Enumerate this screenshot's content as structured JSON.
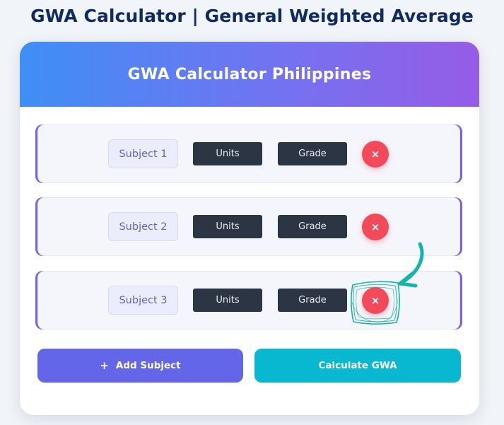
{
  "page": {
    "title": "GWA Calculator | General Weighted Average"
  },
  "card": {
    "header_title": "GWA Calculator Philippines"
  },
  "subjects": [
    {
      "label": "Subject 1",
      "units_placeholder": "Units",
      "grade_placeholder": "Grade",
      "remove_icon": "×"
    },
    {
      "label": "Subject 2",
      "units_placeholder": "Units",
      "grade_placeholder": "Grade",
      "remove_icon": "×"
    },
    {
      "label": "Subject 3",
      "units_placeholder": "Units",
      "grade_placeholder": "Grade",
      "remove_icon": "×"
    }
  ],
  "actions": {
    "add_icon": "+",
    "add_label": "Add Subject",
    "calculate_label": "Calculate GWA"
  },
  "colors": {
    "title": "#0f2b61",
    "header_gradient_start": "#3f8ef6",
    "header_gradient_end": "#965ce6",
    "row_accent": "#7a61e8",
    "input_background": "#2c3544",
    "remove_button": "#f34a5b",
    "add_button": "#6466ea",
    "calculate_button": "#08b8d1",
    "annotation": "#16b3aa"
  },
  "icons": {
    "remove": "close-icon",
    "add": "plus-icon",
    "annotation": "arrow-annotation-icon"
  }
}
